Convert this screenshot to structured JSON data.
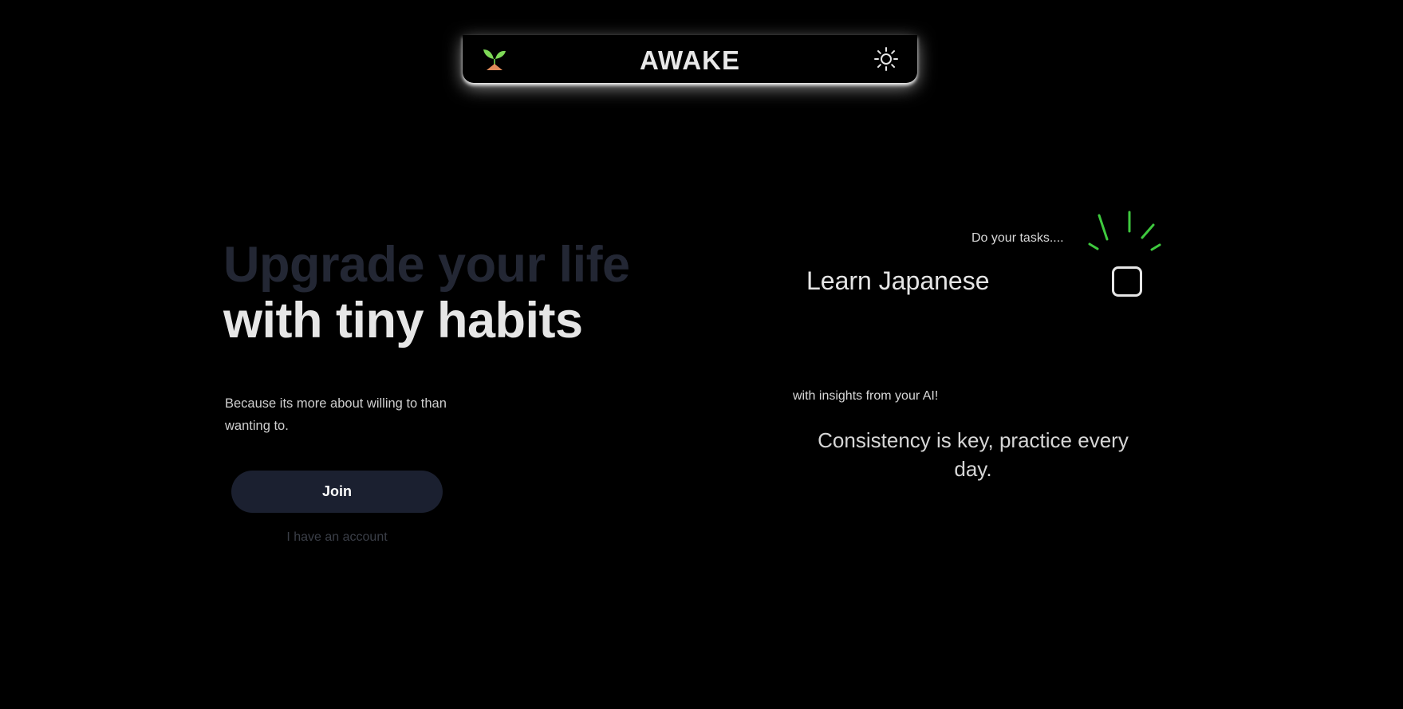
{
  "header": {
    "brand": "AWAKE",
    "logo_icon": "seedling-icon",
    "theme_toggle_icon": "sun-icon"
  },
  "hero": {
    "title_line1": "Upgrade your life",
    "title_line2": "with tiny habits",
    "subtitle": "Because its more about willing to than wanting to.",
    "join_label": "Join",
    "account_label": "I have an account"
  },
  "demo": {
    "tasks_caption": "Do your tasks....",
    "task_label": "Learn Japanese",
    "task_checked": false,
    "ai_caption": "with insights from your AI!",
    "ai_insight": "Consistency is key, practice every day."
  },
  "colors": {
    "background": "#000000",
    "title_dim": "#232734",
    "button_bg": "#1b2030",
    "sparkle": "#3ec93e",
    "leaf": "#7ed957",
    "pot": "#e08b5a"
  }
}
